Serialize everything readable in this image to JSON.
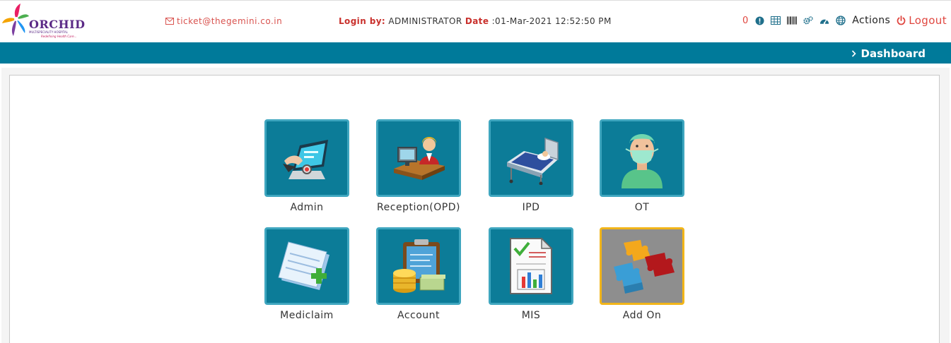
{
  "brand": {
    "name": "ORCHID",
    "subtitle": "MULTISPECIALITY HOSPITAL",
    "tagline": "Redefining Health Care..."
  },
  "header": {
    "email": "ticket@thegemini.co.in",
    "login_label": "Login by:",
    "login_user": "ADMINISTRATOR",
    "date_label": "Date",
    "date_value": ":01-Mar-2021  12:52:50 PM",
    "notification_count": "0",
    "actions_label": "Actions",
    "logout_label": "Logout"
  },
  "nav": {
    "breadcrumb": "Dashboard"
  },
  "modules": [
    {
      "label": "Admin",
      "icon": "admin-icon"
    },
    {
      "label": "Reception(OPD)",
      "icon": "reception-icon"
    },
    {
      "label": "IPD",
      "icon": "hospital-bed-icon"
    },
    {
      "label": "OT",
      "icon": "surgeon-icon"
    },
    {
      "label": "Mediclaim",
      "icon": "claim-form-icon"
    },
    {
      "label": "Account",
      "icon": "account-coins-icon"
    },
    {
      "label": "MIS",
      "icon": "report-chart-icon"
    },
    {
      "label": "Add On",
      "icon": "puzzle-icon"
    }
  ],
  "colors": {
    "primary": "#007a9a",
    "tile": "#0c7c98",
    "accent_red": "#e0463f",
    "selected_border": "#f2b519"
  }
}
